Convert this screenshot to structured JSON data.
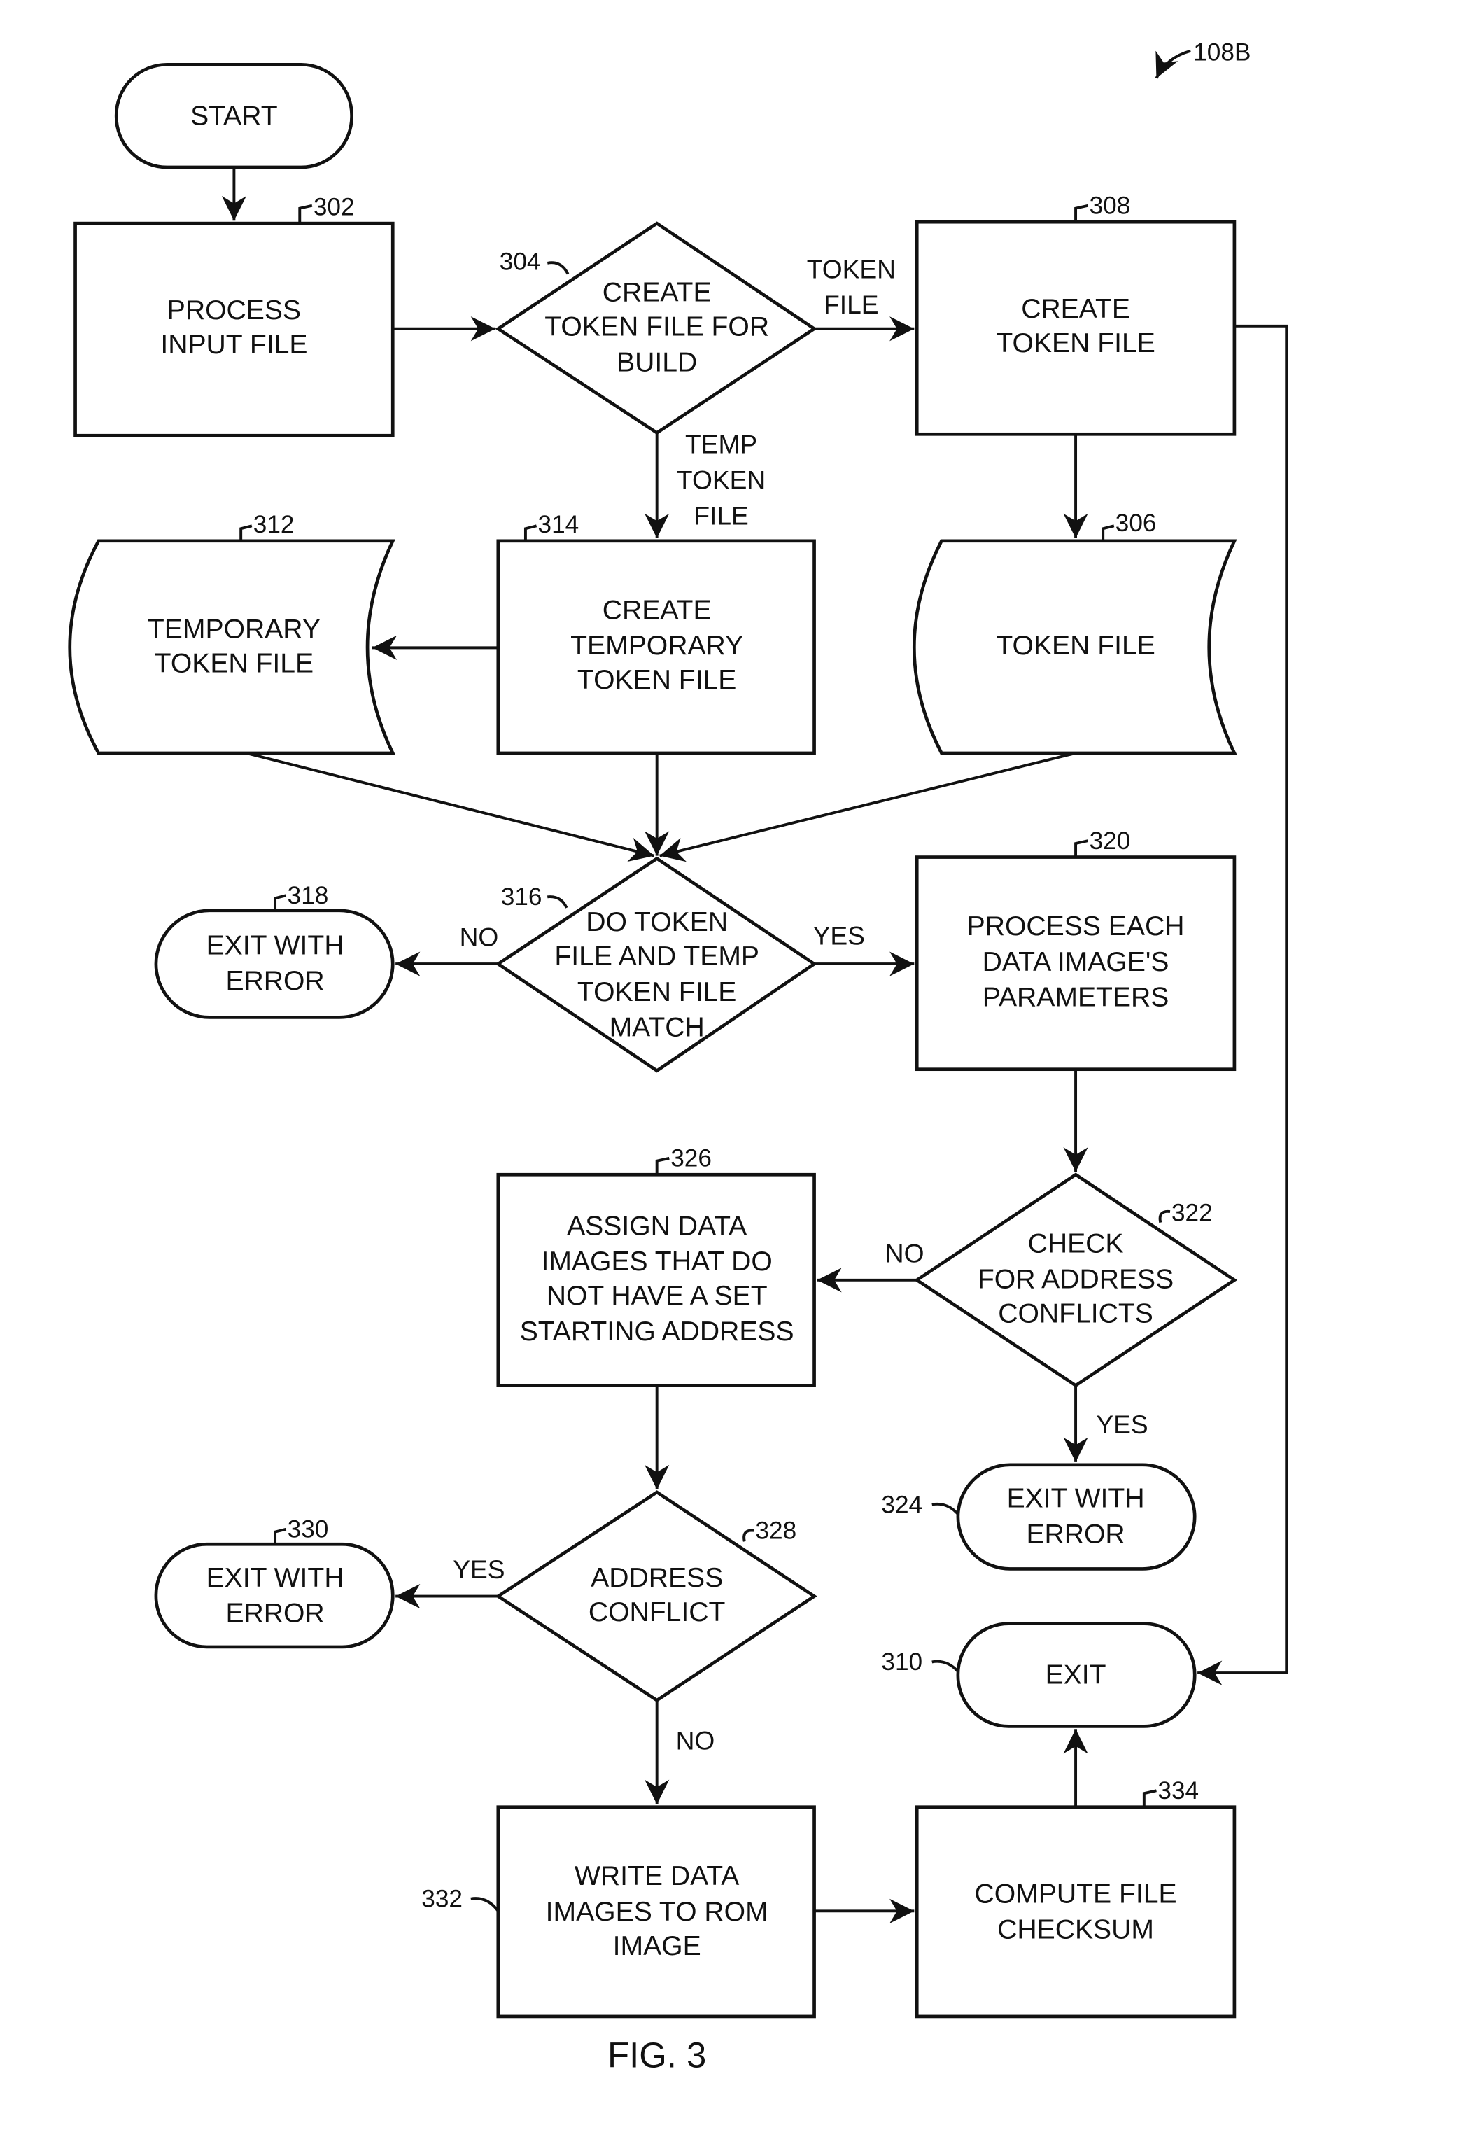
{
  "figure": {
    "reference": "108B",
    "caption": "FIG. 3"
  },
  "nodes": {
    "start": {
      "ref": "",
      "lines": [
        "START"
      ]
    },
    "n302": {
      "ref": "302",
      "lines": [
        "PROCESS",
        "INPUT FILE"
      ]
    },
    "n304": {
      "ref": "304",
      "lines": [
        "CREATE",
        "TOKEN FILE FOR",
        "BUILD"
      ]
    },
    "n308": {
      "ref": "308",
      "lines": [
        "CREATE",
        "TOKEN FILE"
      ]
    },
    "n312": {
      "ref": "312",
      "lines": [
        "TEMPORARY",
        "TOKEN FILE"
      ]
    },
    "n314": {
      "ref": "314",
      "lines": [
        "CREATE",
        "TEMPORARY",
        "TOKEN FILE"
      ]
    },
    "n306": {
      "ref": "306",
      "lines": [
        "TOKEN FILE"
      ]
    },
    "n316": {
      "ref": "316",
      "lines": [
        "DO TOKEN",
        "FILE AND TEMP",
        "TOKEN FILE",
        "MATCH"
      ]
    },
    "n318": {
      "ref": "318",
      "lines": [
        "EXIT WITH",
        "ERROR"
      ]
    },
    "n320": {
      "ref": "320",
      "lines": [
        "PROCESS EACH",
        "DATA IMAGE'S",
        "PARAMETERS"
      ]
    },
    "n322": {
      "ref": "322",
      "lines": [
        "CHECK",
        "FOR ADDRESS",
        "CONFLICTS"
      ]
    },
    "n326": {
      "ref": "326",
      "lines": [
        "ASSIGN DATA",
        "IMAGES THAT DO",
        "NOT HAVE A SET",
        "STARTING ADDRESS"
      ]
    },
    "n324": {
      "ref": "324",
      "lines": [
        "EXIT WITH",
        "ERROR"
      ]
    },
    "n328": {
      "ref": "328",
      "lines": [
        "ADDRESS",
        "CONFLICT"
      ]
    },
    "n330": {
      "ref": "330",
      "lines": [
        "EXIT WITH",
        "ERROR"
      ]
    },
    "n310": {
      "ref": "310",
      "lines": [
        "EXIT"
      ]
    },
    "n332": {
      "ref": "332",
      "lines": [
        "WRITE DATA",
        "IMAGES TO ROM",
        "IMAGE"
      ]
    },
    "n334": {
      "ref": "334",
      "lines": [
        "COMPUTE FILE",
        "CHECKSUM"
      ]
    }
  },
  "edge_labels": {
    "token_file": [
      "TOKEN",
      "FILE"
    ],
    "temp_token_file": [
      "TEMP",
      "TOKEN",
      "FILE"
    ],
    "e316_no": "NO",
    "e316_yes": "YES",
    "e322_no": "NO",
    "e322_yes": "YES",
    "e328_yes": "YES",
    "e328_no": "NO"
  }
}
